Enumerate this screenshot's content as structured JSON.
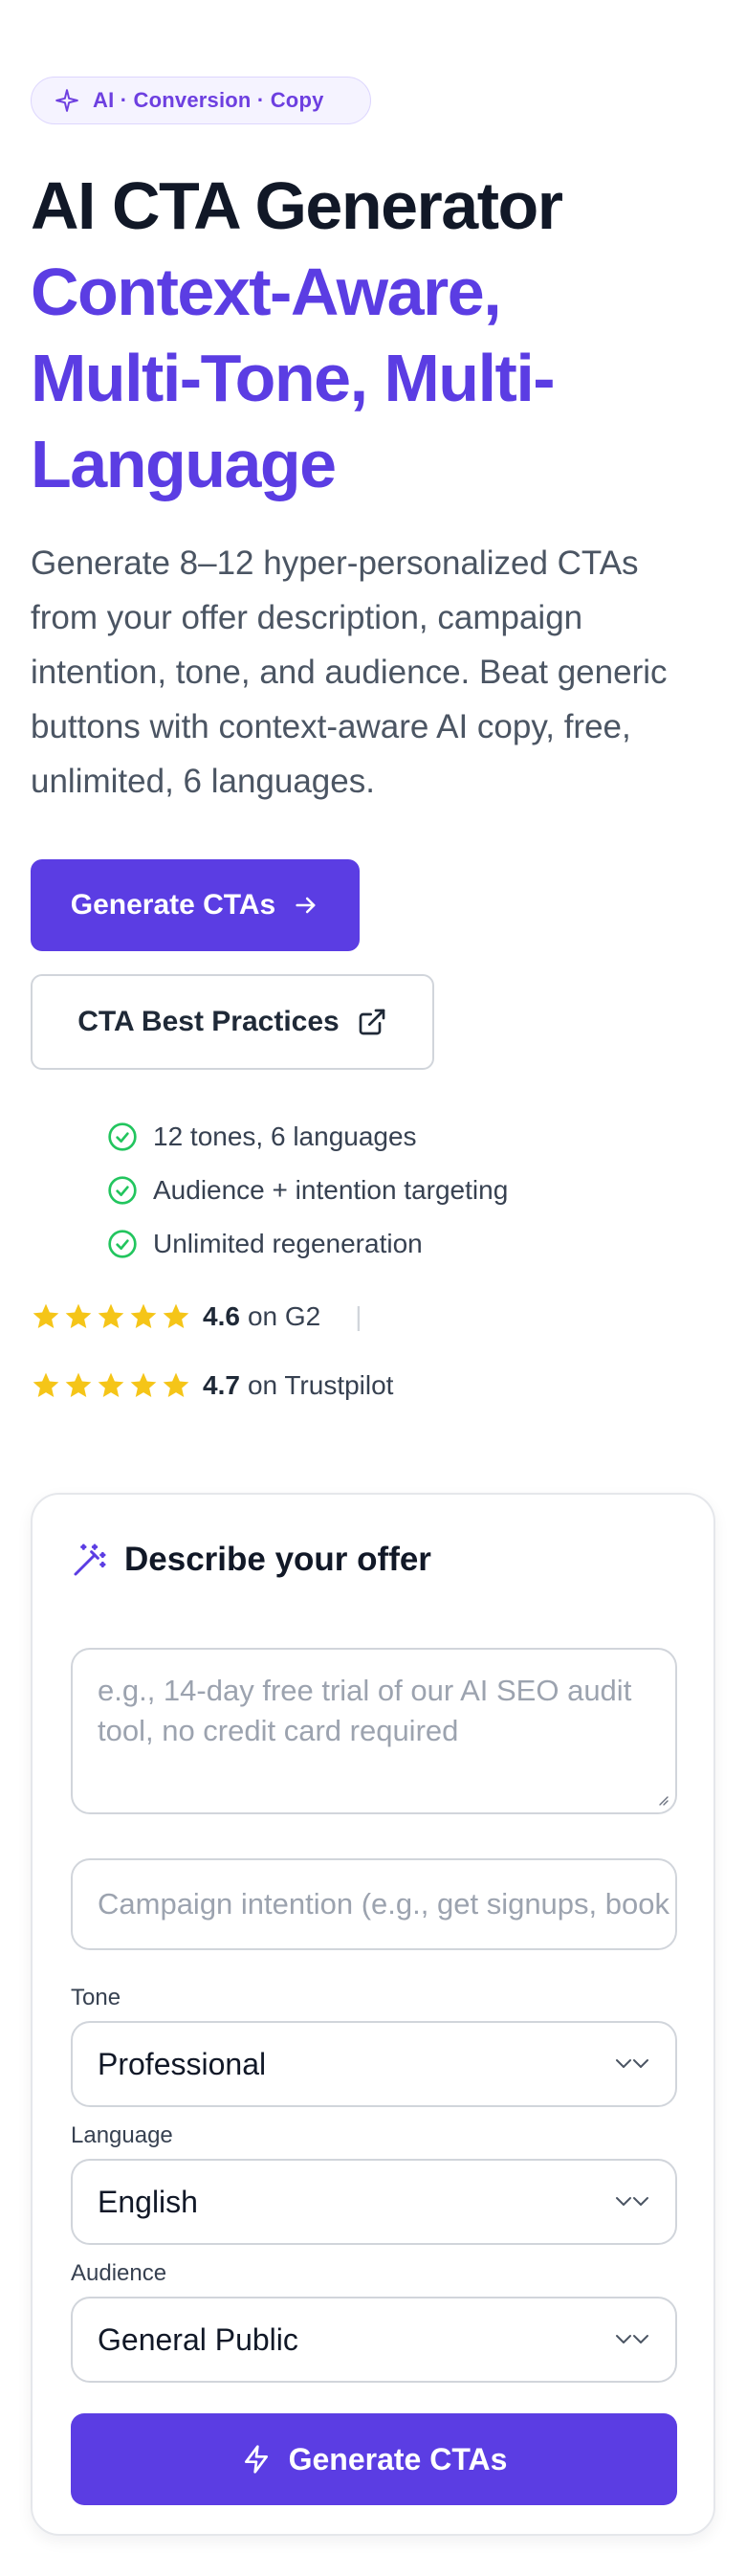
{
  "badge": {
    "icon": "sparkle-icon",
    "text": "AI · Conversion · Copy"
  },
  "hero": {
    "title_line1": "AI CTA Generator",
    "title_line2": "Context-Aware,",
    "title_line3": "Multi-Tone, Multi-",
    "title_line4": "Language",
    "description": "Generate 8–12 hyper-personalized CTAs from your offer description, campaign intention, tone, and audience. Beat generic buttons with context-aware AI copy, free, unlimited, 6 languages."
  },
  "buttons": {
    "primary_label": "Generate CTAs",
    "secondary_label": "CTA Best Practices"
  },
  "features": [
    "12 tones, 6 languages",
    "Audience + intention targeting",
    "Unlimited regeneration"
  ],
  "ratings": [
    {
      "score": "4.6",
      "source": "on G2",
      "stars": 5
    },
    {
      "score": "4.7",
      "source": "on Trustpilot",
      "stars": 5
    }
  ],
  "separator": "|",
  "form": {
    "title": "Describe your offer",
    "offer_placeholder": "e.g., 14-day free trial of our AI SEO audit tool, no credit card required",
    "intention_placeholder": "Campaign intention (e.g., get signups, book demos)",
    "tone_label": "Tone",
    "tone_value": "Professional",
    "language_label": "Language",
    "language_value": "English",
    "audience_label": "Audience",
    "audience_value": "General Public",
    "submit_label": "Generate CTAs"
  },
  "colors": {
    "accent": "#5b3de3",
    "check": "#22c55e",
    "star": "#f5c518"
  }
}
